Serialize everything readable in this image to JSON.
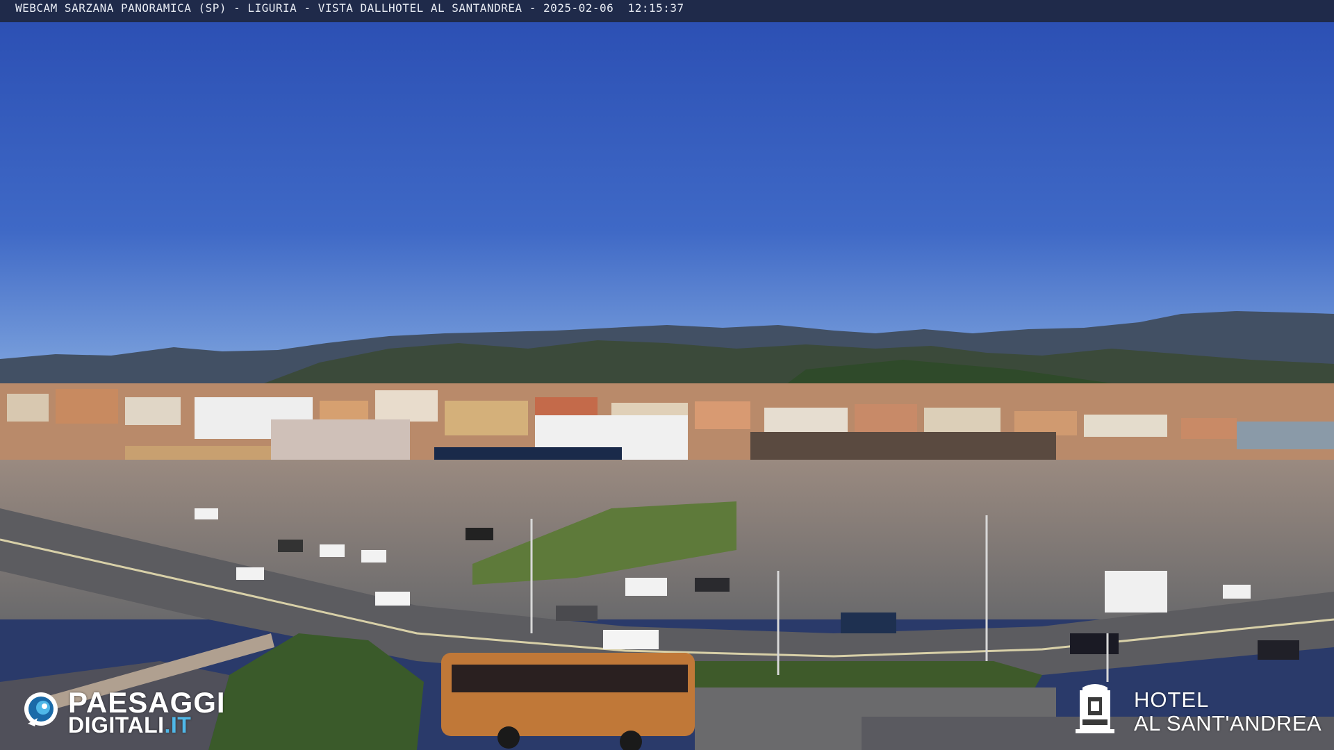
{
  "overlay": {
    "caption": "WEBCAM SARZANA PANORAMICA (SP) - LIGURIA - VISTA DALLHOTEL AL SANTANDREA - 2025-02-06  12:15:37"
  },
  "scene": {
    "subject": "rooftop webcam view of town, car park, road and distant hills",
    "sky_color": "#2f56b8",
    "sky_horizon_color": "#6f95d8",
    "hills_color": "#3c4a4a"
  },
  "watermark_left": {
    "word1": "PAESAGGI",
    "word2": "DIGITALI",
    "tld": ".IT",
    "accent_color": "#4fb8e8"
  },
  "watermark_right": {
    "line1": "HOTEL",
    "line2": "AL SANT'ANDREA"
  }
}
